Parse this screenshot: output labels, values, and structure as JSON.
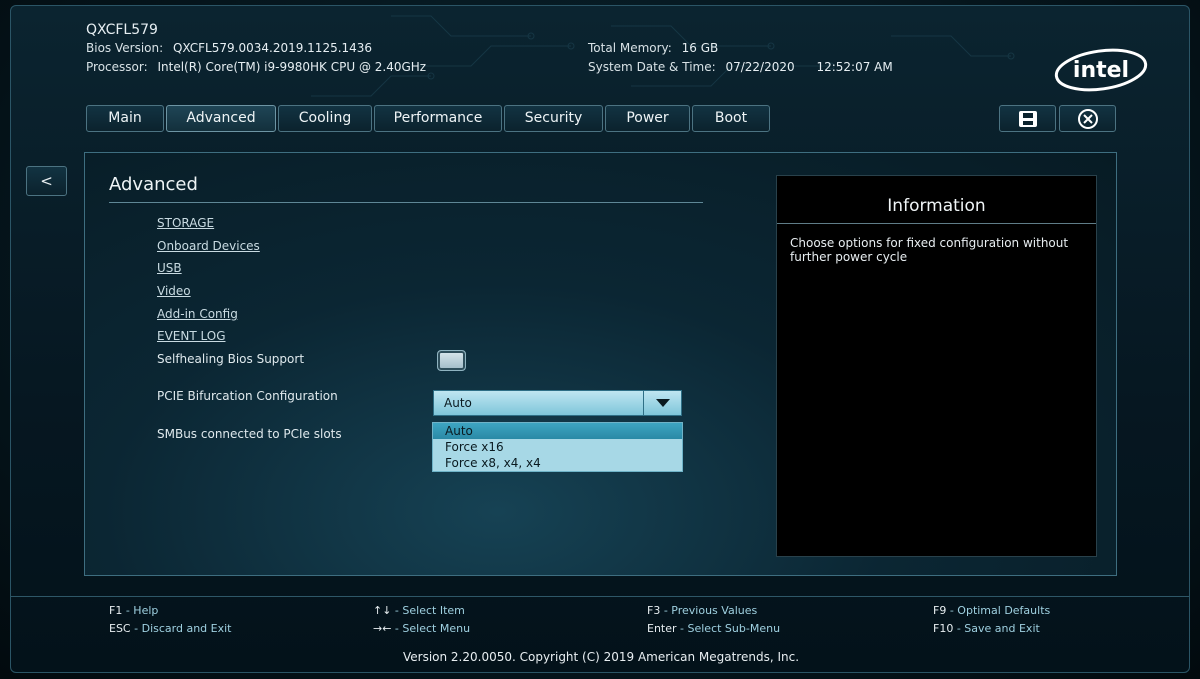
{
  "header": {
    "system_name": "QXCFL579",
    "bios_version_label": "Bios Version:",
    "bios_version_value": "QXCFL579.0034.2019.1125.1436",
    "processor_label": "Processor:",
    "processor_value": "Intel(R) Core(TM) i9-9980HK CPU @ 2.40GHz",
    "total_memory_label": "Total Memory:",
    "total_memory_value": "16 GB",
    "system_datetime_label": "System Date & Time:",
    "system_date": "07/22/2020",
    "system_time": "12:52:07 AM",
    "logo_text": "intel"
  },
  "tabs": [
    {
      "label": "Main",
      "active": false
    },
    {
      "label": "Advanced",
      "active": true
    },
    {
      "label": "Cooling",
      "active": false
    },
    {
      "label": "Performance",
      "active": false
    },
    {
      "label": "Security",
      "active": false
    },
    {
      "label": "Power",
      "active": false
    },
    {
      "label": "Boot",
      "active": false
    }
  ],
  "toolbar": {
    "save_icon": "save-icon",
    "exit_icon": "close-circle-icon",
    "back_label": "<"
  },
  "panel": {
    "title": "Advanced",
    "menu_links": [
      "STORAGE",
      "Onboard Devices",
      "USB",
      "Video",
      "Add-in Config",
      "EVENT LOG"
    ],
    "settings": {
      "selfhealing_label": "Selfhealing Bios Support",
      "selfhealing_enabled": false,
      "pcie_label": "PCIE Bifurcation Configuration",
      "pcie_value": "Auto",
      "smbus_label": "SMBus connected to PCIe slots"
    },
    "dropdown_options": [
      "Auto",
      "Force x16",
      "Force x8, x4, x4"
    ],
    "dropdown_selected": "Auto"
  },
  "info": {
    "title": "Information",
    "text": "Choose options for fixed configuration without further power cycle"
  },
  "footer": {
    "keys": [
      {
        "key": "F1",
        "sep": " - ",
        "action": "Help"
      },
      {
        "key": "ESC",
        "sep": " - ",
        "action": "Discard and Exit"
      },
      {
        "key": "↑↓",
        "sep": " - ",
        "action": "Select Item"
      },
      {
        "key": "→←",
        "sep": " - ",
        "action": "Select Menu"
      },
      {
        "key": "F3",
        "sep": " - ",
        "action": "Previous Values"
      },
      {
        "key": "Enter",
        "sep": " - ",
        "action": "Select Sub-Menu"
      },
      {
        "key": "F9",
        "sep": " - ",
        "action": "Optimal Defaults"
      },
      {
        "key": "F10",
        "sep": " - ",
        "action": "Save and Exit"
      }
    ],
    "version": "Version 2.20.0050. Copyright (C) 2019 American Megatrends, Inc."
  },
  "colors": {
    "accent": "#3ea5c2",
    "panel_border": "#3e6e80",
    "background": "#061821"
  }
}
